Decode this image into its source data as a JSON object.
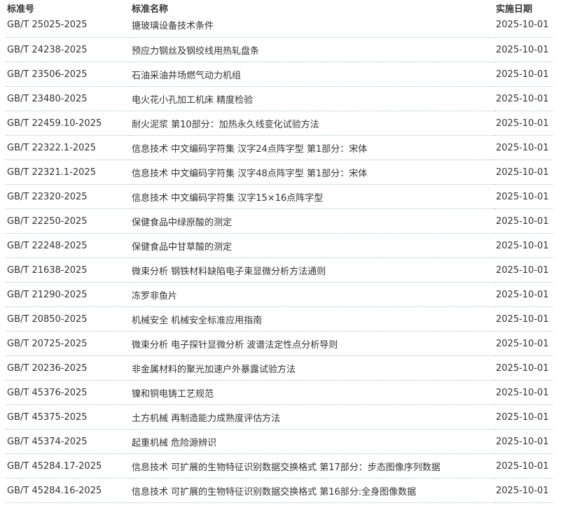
{
  "table": {
    "headers": {
      "code": "标准号",
      "name": "标准名称",
      "date": "实施日期"
    },
    "rows": [
      {
        "code": "GB/T 25025-2025",
        "name": "搪玻璃设备技术条件",
        "date": "2025-10-01"
      },
      {
        "code": "GB/T 24238-2025",
        "name": "预应力钢丝及钢绞线用热轧盘条",
        "date": "2025-10-01"
      },
      {
        "code": "GB/T 23506-2025",
        "name": "石油采油井场燃气动力机组",
        "date": "2025-10-01"
      },
      {
        "code": "GB/T 23480-2025",
        "name": "电火花小孔加工机床 精度检验",
        "date": "2025-10-01"
      },
      {
        "code": "GB/T 22459.10-2025",
        "name": "耐火泥浆 第10部分：加热永久线变化试验方法",
        "date": "2025-10-01"
      },
      {
        "code": "GB/T 22322.1-2025",
        "name": "信息技术 中文编码字符集 汉字24点阵字型 第1部分：宋体",
        "date": "2025-10-01"
      },
      {
        "code": "GB/T 22321.1-2025",
        "name": "信息技术 中文编码字符集 汉字48点阵字型 第1部分：宋体",
        "date": "2025-10-01"
      },
      {
        "code": "GB/T 22320-2025",
        "name": "信息技术 中文编码字符集 汉字15×16点阵字型",
        "date": "2025-10-01"
      },
      {
        "code": "GB/T 22250-2025",
        "name": "保健食品中绿原酸的测定",
        "date": "2025-10-01"
      },
      {
        "code": "GB/T 22248-2025",
        "name": "保健食品中甘草酸的测定",
        "date": "2025-10-01"
      },
      {
        "code": "GB/T 21638-2025",
        "name": "微束分析 钢铁材料缺陷电子束显微分析方法通则",
        "date": "2025-10-01"
      },
      {
        "code": "GB/T 21290-2025",
        "name": "冻罗非鱼片",
        "date": "2025-10-01"
      },
      {
        "code": "GB/T 20850-2025",
        "name": "机械安全 机械安全标准应用指南",
        "date": "2025-10-01"
      },
      {
        "code": "GB/T 20725-2025",
        "name": "微束分析 电子探针显微分析 波谱法定性点分析导则",
        "date": "2025-10-01"
      },
      {
        "code": "GB/T 20236-2025",
        "name": "非金属材料的聚光加速户外暴露试验方法",
        "date": "2025-10-01"
      },
      {
        "code": "GB/T 45376-2025",
        "name": "镍和铜电铸工艺规范",
        "date": "2025-10-01"
      },
      {
        "code": "GB/T 45375-2025",
        "name": "土方机械 再制造能力成熟度评估方法",
        "date": "2025-10-01"
      },
      {
        "code": "GB/T 45374-2025",
        "name": "起重机械 危险源辨识",
        "date": "2025-10-01"
      },
      {
        "code": "GB/T 45284.17-2025",
        "name": "信息技术 可扩展的生物特征识别数据交换格式 第17部分：步态图像序列数据",
        "date": "2025-10-01"
      },
      {
        "code": "GB/T 45284.16-2025",
        "name": "信息技术 可扩展的生物特征识别数据交换格式 第16部分:全身图像数据",
        "date": "2025-10-01"
      }
    ]
  }
}
